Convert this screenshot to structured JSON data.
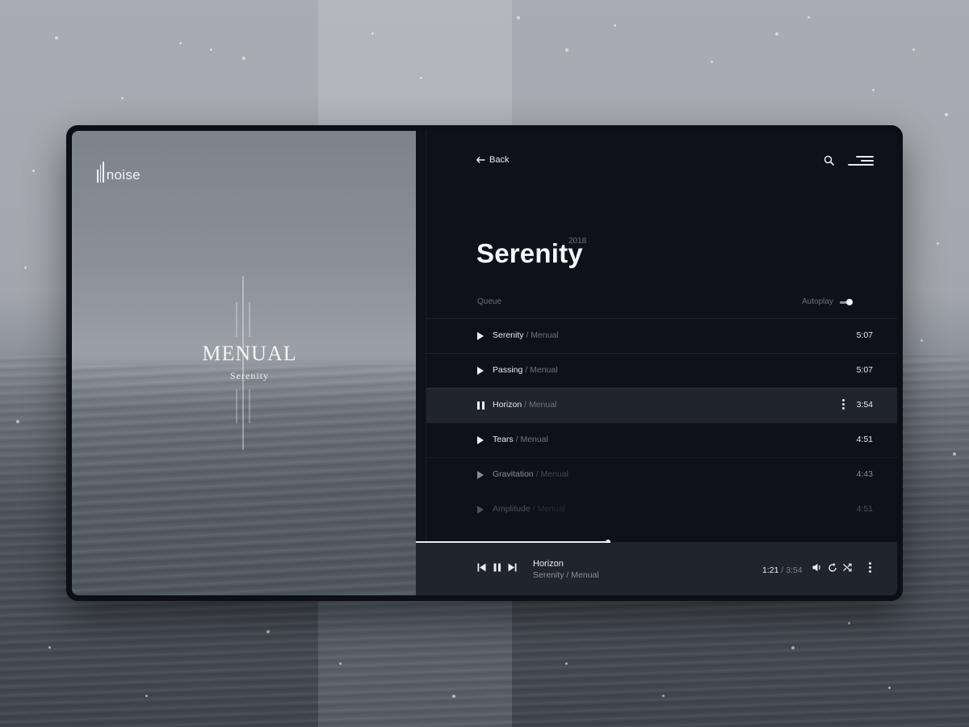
{
  "brand": {
    "logo_text": "noise"
  },
  "album_art": {
    "artist": "MENUAL",
    "album": "Serenity"
  },
  "nav": {
    "back_label": "Back",
    "search_icon": "search-icon",
    "menu_icon": "menu-icon"
  },
  "album": {
    "title": "Serenity",
    "year": "2018"
  },
  "queue": {
    "label": "Queue",
    "autoplay_label": "Autoplay",
    "autoplay_on": true,
    "tracks": [
      {
        "title": "Serenity",
        "artist": "/ Menual",
        "duration": "5:07",
        "state": "play"
      },
      {
        "title": "Passing",
        "artist": "/ Menual",
        "duration": "5:07",
        "state": "play"
      },
      {
        "title": "Horizon",
        "artist": "/ Menual",
        "duration": "3:54",
        "state": "playing"
      },
      {
        "title": "Tears",
        "artist": "/ Menual",
        "duration": "4:51",
        "state": "play"
      },
      {
        "title": "Gravitation",
        "artist": "/ Menual",
        "duration": "4:43",
        "state": "play"
      },
      {
        "title": "Amplitude",
        "artist": "/ Menual",
        "duration": "4:51",
        "state": "play"
      }
    ]
  },
  "now_playing": {
    "title": "Horizon",
    "subtitle": "Serenity / Menual",
    "elapsed": "1:21",
    "total": "/ 3:54",
    "progress_fraction": 0.4
  },
  "colors": {
    "panel": "#0e111a",
    "active_row": "#20242e",
    "player_bar": "#20242d",
    "text": "#e9ebef",
    "muted": "#6d737e"
  }
}
